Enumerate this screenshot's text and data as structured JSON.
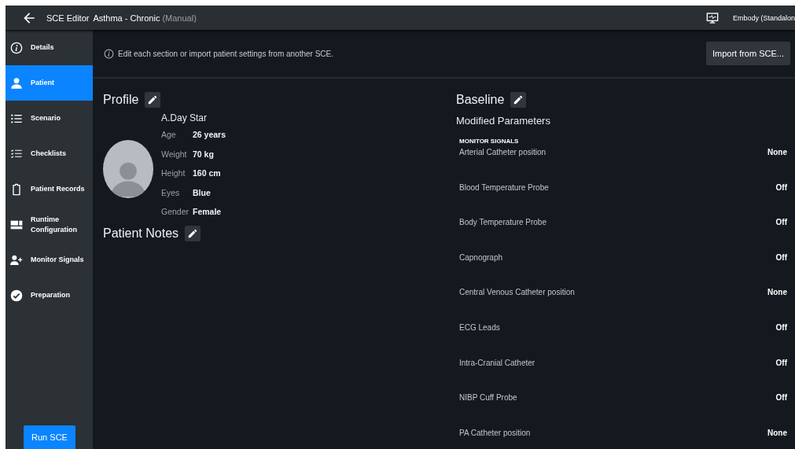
{
  "top_bar": {
    "title": "SCE Editor",
    "scenario": "Asthma - Chronic",
    "mode": "(Manual)",
    "device": "Embody (Standalon"
  },
  "sidebar": {
    "items": [
      {
        "label": "Details",
        "selected": false
      },
      {
        "label": "Patient",
        "selected": true
      },
      {
        "label": "Scenario",
        "selected": false
      },
      {
        "label": "Checklists",
        "selected": false
      },
      {
        "label": "Patient Records",
        "selected": false
      },
      {
        "label": "Runtime Configuration",
        "selected": false
      },
      {
        "label": "Monitor Signals",
        "selected": false
      },
      {
        "label": "Preparation",
        "selected": false
      }
    ],
    "run_button": "Run SCE"
  },
  "info_bar": {
    "message": "Edit each section or import patient settings from another SCE.",
    "import_button": "Import from SCE..."
  },
  "profile": {
    "heading": "Profile",
    "name": "A.Day Star",
    "fields": [
      {
        "label": "Age",
        "value": "26 years"
      },
      {
        "label": "Weight",
        "value": "70 kg"
      },
      {
        "label": "Height",
        "value": "160 cm"
      },
      {
        "label": "Eyes",
        "value": "Blue"
      },
      {
        "label": "Gender",
        "value": "Female"
      }
    ]
  },
  "patient_notes": {
    "heading": "Patient Notes"
  },
  "baseline": {
    "heading": "Baseline",
    "subheading": "Modified Parameters",
    "group": "MONITOR SIGNALS",
    "parameters": [
      {
        "label": "Arterial Catheter position",
        "value": "None"
      },
      {
        "label": "Blood Temperature Probe",
        "value": "Off"
      },
      {
        "label": "Body Temperature Probe",
        "value": "Off"
      },
      {
        "label": "Capnograph",
        "value": "Off"
      },
      {
        "label": "Central Venous Catheter position",
        "value": "None"
      },
      {
        "label": "ECG Leads",
        "value": "Off"
      },
      {
        "label": "Intra-Cranial Catheter",
        "value": "Off"
      },
      {
        "label": "NIBP Cuff Probe",
        "value": "Off"
      },
      {
        "label": "PA Catheter position",
        "value": "None"
      }
    ]
  }
}
